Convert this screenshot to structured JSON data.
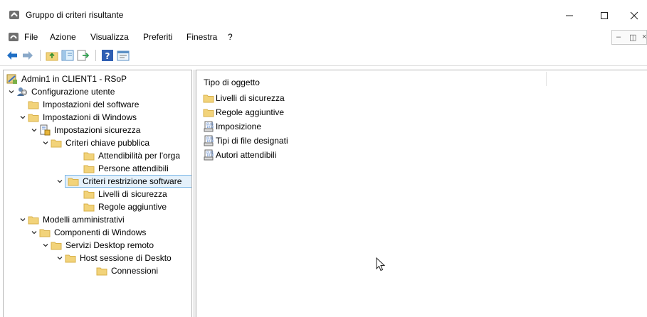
{
  "window": {
    "title": "Gruppo di criteri risultante",
    "controls": [
      "minimize",
      "maximize",
      "close"
    ]
  },
  "menubar": {
    "items": [
      "File",
      "Azione",
      "Visualizza",
      "Preferiti",
      "Finestra",
      "?"
    ]
  },
  "toolbar": {
    "buttons": [
      "back-arrow-icon",
      "forward-arrow-icon",
      "up-folder-icon",
      "show-hide-tree-icon",
      "export-list-icon",
      "help-icon",
      "properties-icon"
    ]
  },
  "tree": {
    "nodes": [
      {
        "label": "Admin1 in CLIENT1 - RSoP",
        "icon": "rsop-icon",
        "level": 0,
        "chevron": "none"
      },
      {
        "label": "Configurazione utente",
        "icon": "user-config-icon",
        "level": 0,
        "chevron": "expanded"
      },
      {
        "label": "Impostazioni del software",
        "icon": "folder-icon",
        "level": 1,
        "chevron": "none"
      },
      {
        "label": "Impostazioni di Windows",
        "icon": "folder-icon",
        "level": 1,
        "chevron": "expanded"
      },
      {
        "label": "Impostazioni sicurezza",
        "icon": "security-icon",
        "level": 2,
        "chevron": "expanded"
      },
      {
        "label": "Criteri chiave pubblica",
        "icon": "folder-icon",
        "level": 3,
        "chevron": "expanded"
      },
      {
        "label": "Attendibilità per l'orga",
        "icon": "folder-icon",
        "level": 4,
        "chevron": "none"
      },
      {
        "label": "Persone attendibili",
        "icon": "folder-icon",
        "level": 4,
        "chevron": "none"
      },
      {
        "label": "Criteri restrizione software",
        "icon": "folder-icon",
        "level": 3,
        "chevron": "expanded",
        "selected": true
      },
      {
        "label": "Livelli di sicurezza",
        "icon": "folder-icon",
        "level": 4,
        "chevron": "none"
      },
      {
        "label": "Regole aggiuntive",
        "icon": "folder-icon",
        "level": 4,
        "chevron": "none"
      },
      {
        "label": "Modelli amministrativi",
        "icon": "folder-icon",
        "level": 1,
        "chevron": "expanded"
      },
      {
        "label": "Componenti di Windows",
        "icon": "folder-icon",
        "level": 2,
        "chevron": "expanded"
      },
      {
        "label": "Servizi Desktop remoto",
        "icon": "folder-icon",
        "level": 3,
        "chevron": "expanded"
      },
      {
        "label": "Host sessione di Deskto",
        "icon": "folder-icon",
        "level": 4,
        "chevron": "expanded"
      },
      {
        "label": "Connessioni",
        "icon": "folder-icon",
        "level": 5,
        "chevron": "none"
      }
    ]
  },
  "list": {
    "column_header": "Tipo di oggetto",
    "rows": [
      {
        "label": "Livelli di sicurezza",
        "icon": "folder-icon"
      },
      {
        "label": "Regole aggiuntive",
        "icon": "folder-icon"
      },
      {
        "label": "Imposizione",
        "icon": "policy-doc-icon"
      },
      {
        "label": "Tipi di file designati",
        "icon": "policy-doc-icon"
      },
      {
        "label": "Autori attendibili",
        "icon": "policy-doc-icon"
      }
    ]
  },
  "colors": {
    "folder": "#f2d37a",
    "folder_edge": "#d8b04a",
    "selection_bg": "#e5f1fb",
    "selection_border": "#7ab6e6",
    "nav_arrow": "#1f6fc5"
  }
}
